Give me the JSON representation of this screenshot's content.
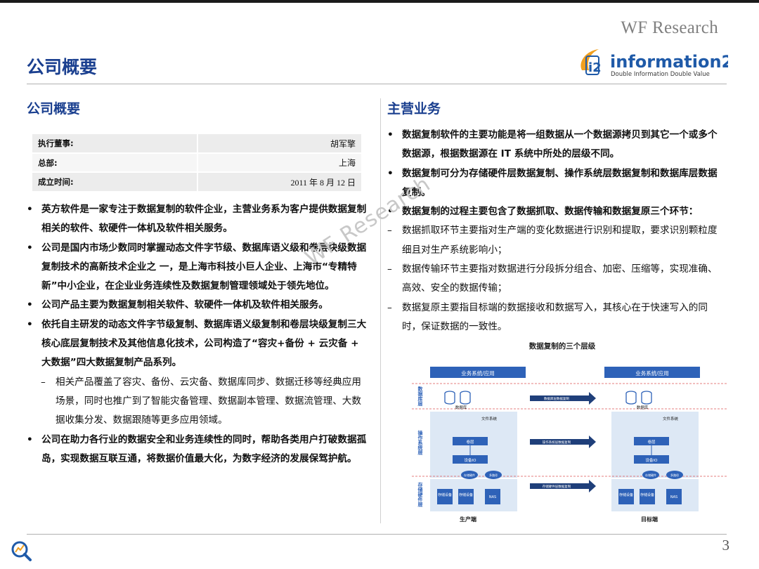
{
  "header": {
    "brand": "WF Research",
    "page_title": "公司概要",
    "logo": {
      "mark": "i2",
      "name": "information2",
      "tagline": "Double Information Double Value"
    }
  },
  "left": {
    "section_title": "公司概要",
    "info_table": [
      {
        "key": "执行董事:",
        "value": "胡军擎"
      },
      {
        "key": "总部:",
        "value": "上海"
      },
      {
        "key": "成立时间:",
        "value": "2011 年 8 月 12 日"
      }
    ],
    "bullets": [
      {
        "type": "bullet",
        "text": "英方软件是一家专注于数据复制的软件企业，主营业务系为客户提供数据复制相关的软件、软硬件一体机及软件相关服务。"
      },
      {
        "type": "bullet",
        "text": "公司是国内市场少数同时掌握动态文件字节级、数据库语义级和卷层块级数据复制技术的高新技术企业之 一，是上海市科技小巨人企业、上海市“专精特新”中小企业，在企业业务连续性及数据复制管理领域处于领先地位。"
      },
      {
        "type": "bullet",
        "text": "公司产品主要为数据复制相关软件、软硬件一体机及软件相关服务。"
      },
      {
        "type": "bullet",
        "text": "依托自主研发的动态文件字节级复制、数据库语义级复制和卷层块级复制三大核心底层复制技术及其他信息化技术，公司构造了“容灾+备份 + 云灾备 + 大数据”四大数据复制产品系列。"
      },
      {
        "type": "sub",
        "text": "相关产品覆盖了容灾、备份、云灾备、数据库同步、数据迁移等经典应用场景，同时也推广到了智能灾备管理、数据副本管理、数据流管理、大数据收集分发、数据跟随等更多应用领域。"
      },
      {
        "type": "bullet",
        "text": "公司在助力各行业的数据安全和业务连续性的同时，帮助各类用户打破数据孤岛，实现数据互联互通，将数据价值最大化，为数字经济的发展保驾护航。"
      }
    ]
  },
  "right": {
    "section_title": "主营业务",
    "bullets": [
      {
        "type": "bullet",
        "text": "数据复制软件的主要功能是将一组数据从一个数据源拷贝到其它一个或多个数据源，根据数据源在 IT 系统中所处的层级不同。"
      },
      {
        "type": "bullet",
        "text": "数据复制可分为存储硬件层数据复制、操作系统层数据复制和数据库层数据复制。"
      },
      {
        "type": "bullet",
        "text": "数据复制的过程主要包含了数据抓取、数据传输和数据复原三个环节："
      },
      {
        "type": "dash",
        "text": "数据抓取环节主要指对生产端的变化数据进行识别和提取，要求识别颗粒度细且对生产系统影响小；"
      },
      {
        "type": "dash",
        "text": "数据传输环节主要指对数据进行分段拆分组合、加密、压缩等，实现准确、高效、安全的数据传输；"
      },
      {
        "type": "dash",
        "text": "数据复原主要指目标端的数据接收和数据写入，其核心在于快速写入的同时，保证数据的一致性。"
      }
    ],
    "diagram": {
      "title": "数据复制的三个层级",
      "layers": [
        "数据库层",
        "操作系统层",
        "存储硬件层"
      ],
      "app_label": "业务系统/应用",
      "db_label": "数据库",
      "fs_label": "文件系统",
      "volume_label": "卷层",
      "io_label": "设备IO",
      "bus_labels": [
        "存储硬件",
        "多路径"
      ],
      "storage": [
        "存储设备",
        "存储设备",
        "NAS"
      ],
      "arrows": [
        "数据库层数据复制",
        "操作系统层数据复制",
        "存储硬件层数据复制"
      ],
      "source_label": "生产端",
      "target_label": "目标端"
    }
  },
  "watermark": "WF Research",
  "footer": {
    "page": "3"
  },
  "colors": {
    "title_blue": "#1a3f8f",
    "diagram_blue": "#2e62b8",
    "panel_bg": "#dde8f5"
  }
}
